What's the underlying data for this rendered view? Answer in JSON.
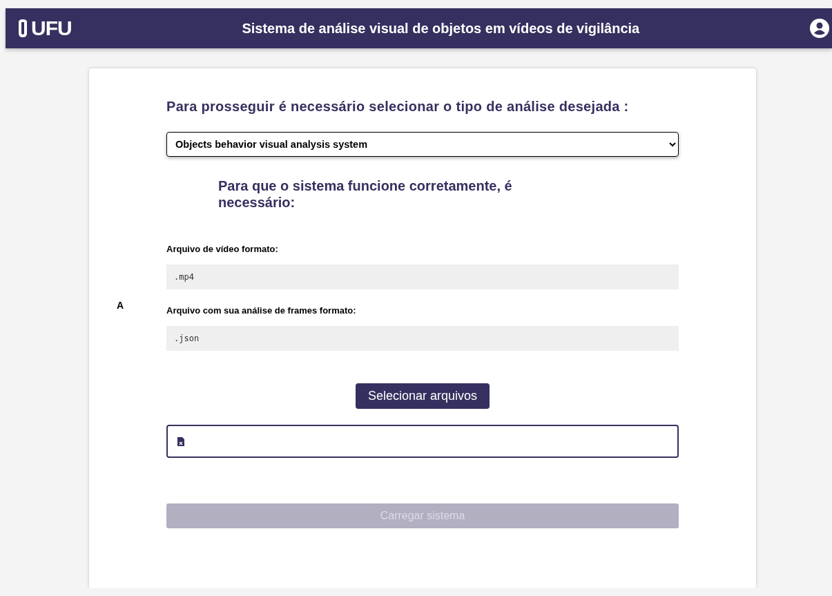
{
  "header": {
    "logo_text": "UFU",
    "title": "Sistema de análise visual de objetos em vídeos de vigilância"
  },
  "form": {
    "prompt": "Para prosseguir é necessário selecionar o tipo de análise desejada :",
    "analysis_select": {
      "value": "Objects behavior visual analysis system"
    },
    "requirements_heading": "Para que o sistema funcione corretamente, é necessário:",
    "side_letter": "A",
    "requirements": [
      {
        "label": "Arquivo de vídeo formato:",
        "format": ".mp4"
      },
      {
        "label": "Arquivo com sua análise de frames formato:",
        "format": ".json"
      }
    ],
    "select_files_button": "Selecionar arquivos",
    "load_button": {
      "label": "Carregar sistema",
      "disabled": true
    }
  }
}
